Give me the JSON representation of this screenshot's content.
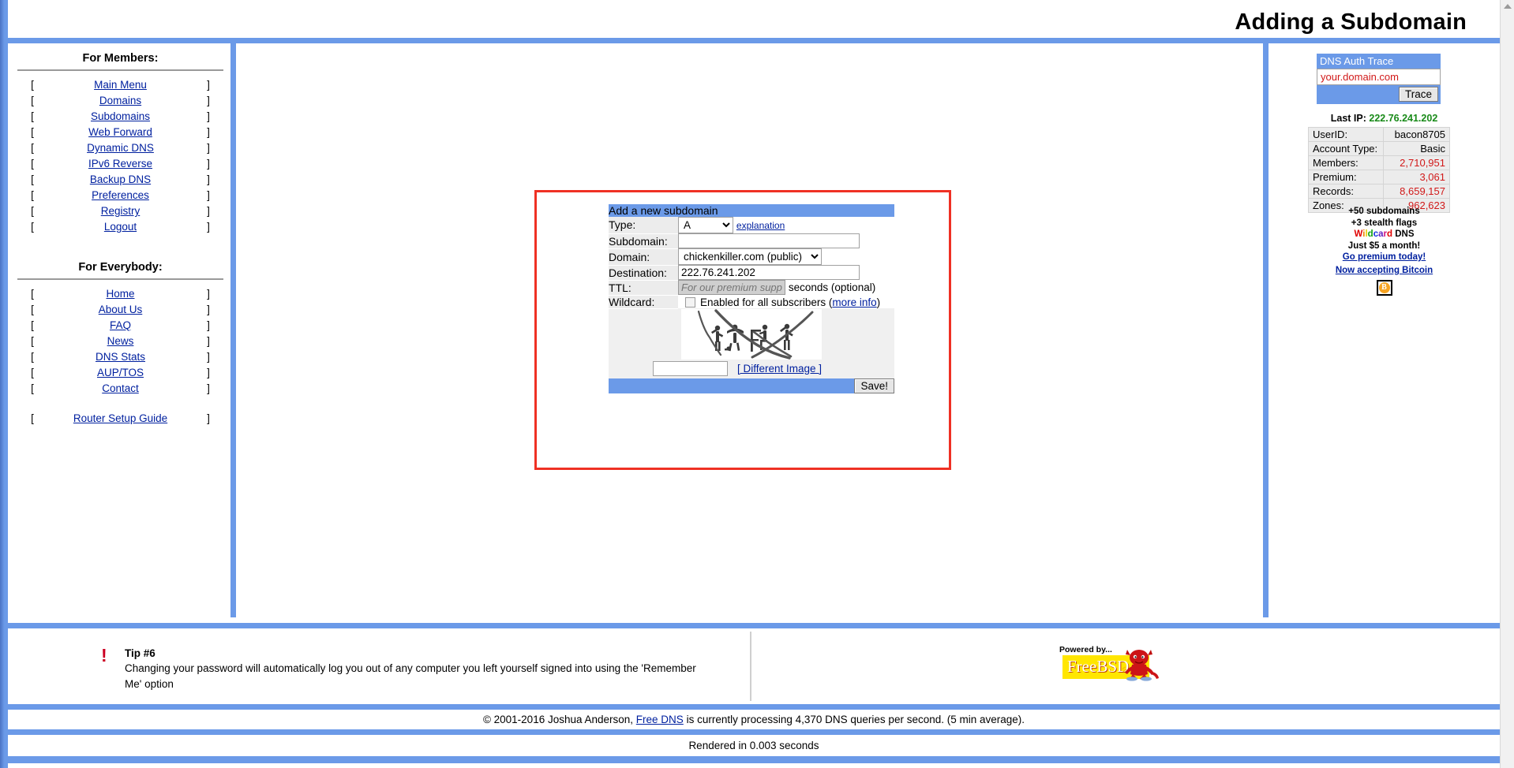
{
  "header": {
    "title": "Adding a Subdomain"
  },
  "sidebar": {
    "members_heading": "For Members:",
    "everybody_heading": "For Everybody:",
    "bracket_left": "[",
    "bracket_right": "]",
    "members_items": [
      {
        "label": "Main Menu"
      },
      {
        "label": "Domains"
      },
      {
        "label": "Subdomains"
      },
      {
        "label": "Web Forward"
      },
      {
        "label": "Dynamic DNS"
      },
      {
        "label": "IPv6 Reverse"
      },
      {
        "label": "Backup DNS"
      },
      {
        "label": "Preferences"
      },
      {
        "label": "Registry"
      },
      {
        "label": "Logout"
      }
    ],
    "everybody_items": [
      {
        "label": "Home"
      },
      {
        "label": "About Us"
      },
      {
        "label": "FAQ"
      },
      {
        "label": "News"
      },
      {
        "label": "DNS Stats"
      },
      {
        "label": "AUP/TOS"
      },
      {
        "label": "Contact"
      }
    ],
    "extra_items": [
      {
        "label": "Router Setup Guide"
      }
    ]
  },
  "form": {
    "title": "Add a new subdomain",
    "type_label": "Type:",
    "type_value": "A",
    "type_options": [
      "A"
    ],
    "explanation_link": "explanation",
    "subdomain_label": "Subdomain:",
    "subdomain_value": "",
    "domain_label": "Domain:",
    "domain_value": "chickenkiller.com (public)",
    "domain_options": [
      "chickenkiller.com (public)"
    ],
    "destination_label": "Destination:",
    "destination_value": "222.76.241.202",
    "ttl_label": "TTL:",
    "ttl_placeholder": "For our premium suppor",
    "ttl_suffix": "seconds (optional)",
    "wildcard_label": "Wildcard:",
    "wildcard_text": "Enabled for all subscribers (",
    "wildcard_more_info": "more info",
    "wildcard_text_end": ")",
    "captcha_value": "",
    "different_image_link": "[ Different Image ]",
    "save_label": "Save!"
  },
  "right_panel": {
    "trace_title": "DNS Auth Trace",
    "trace_value": "your.domain.com",
    "trace_button": "Trace",
    "last_ip_label": "Last IP:",
    "last_ip_value": "222.76.241.202",
    "stats": [
      {
        "key": "UserID:",
        "value": "bacon8705",
        "red": false
      },
      {
        "key": "Account Type:",
        "value": "Basic",
        "red": false
      },
      {
        "key": "Members:",
        "value": "2,710,951",
        "red": true
      },
      {
        "key": "Premium:",
        "value": "3,061",
        "red": true
      },
      {
        "key": "Records:",
        "value": "8,659,157",
        "red": true
      },
      {
        "key": "Zones:",
        "value": "962,623",
        "red": true
      }
    ],
    "promo_line1": "+50 subdomains",
    "promo_line2": "+3 stealth flags",
    "promo_wildcard": "Wildcard",
    "promo_dns": " DNS",
    "promo_line4": "Just $5 a month!",
    "promo_link": "Go premium today!",
    "bitcoin_link": "Now accepting Bitcoin",
    "bitcoin_symbol": "B"
  },
  "tip": {
    "title": "Tip #6",
    "body": "Changing your password will automatically log you out of any computer you left yourself signed into using the 'Remember Me' option",
    "bang": "!"
  },
  "freebsd": {
    "powered_by": "Powered by...",
    "name": "FreeBSD"
  },
  "footer": {
    "copyright_prefix": "© 2001-2016 Joshua Anderson, ",
    "copyright_link": "Free DNS",
    "copyright_suffix": " is currently processing 4,370 DNS queries per second. (5 min average).",
    "render_time": "Rendered in 0.003 seconds"
  }
}
